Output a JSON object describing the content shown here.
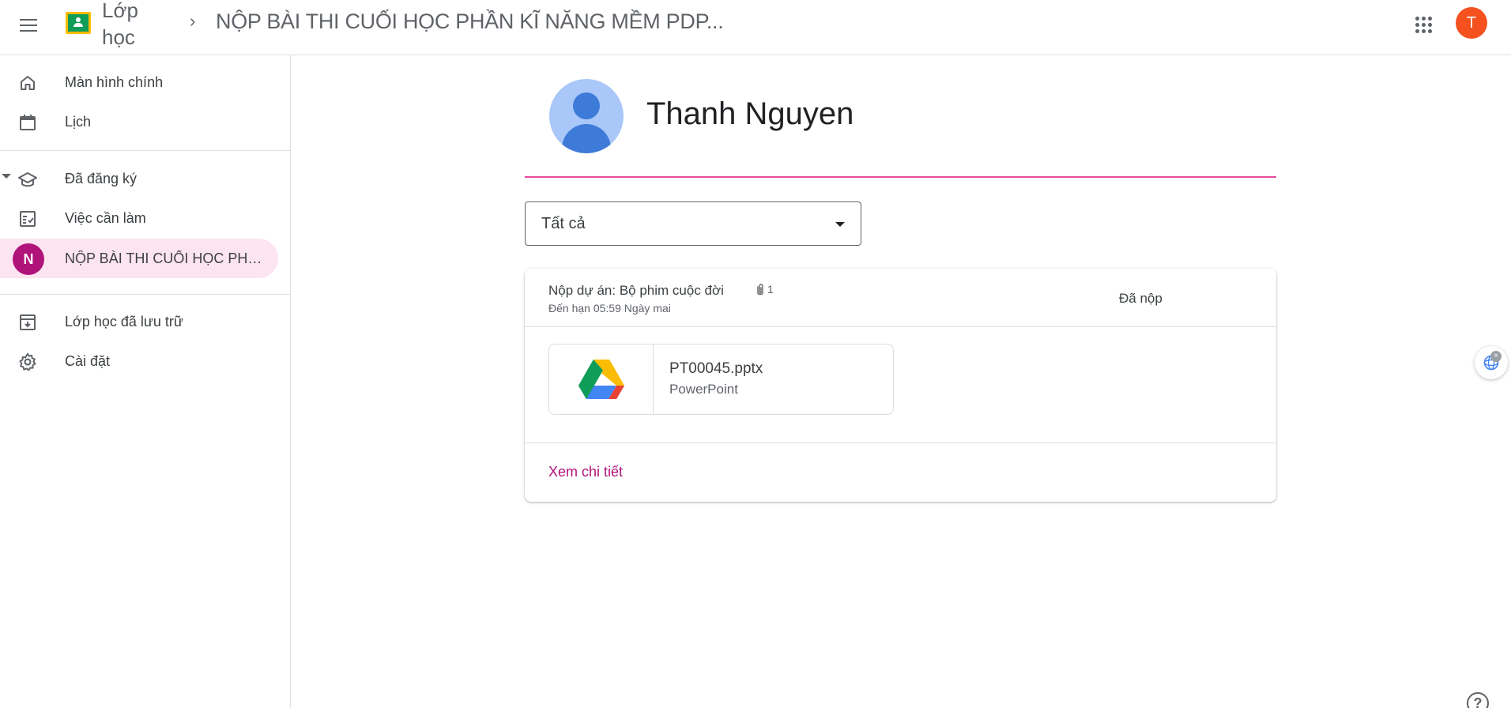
{
  "header": {
    "app_name": "Lớp học",
    "breadcrumb_separator": "›",
    "class_title": "NỘP BÀI THI CUỐI HỌC PHẦN KĨ NĂNG MỀM PDP...",
    "account_initial": "T"
  },
  "sidebar": {
    "items": [
      {
        "label": "Màn hình chính",
        "icon": "home-icon"
      },
      {
        "label": "Lịch",
        "icon": "calendar-icon"
      },
      {
        "label": "Đã đăng ký",
        "icon": "school-icon"
      },
      {
        "label": "Việc cần làm",
        "icon": "checklist-icon"
      },
      {
        "label": "NỘP BÀI THI CUỐI HỌC PHẦN KĨ NĂNG MỀM PDP",
        "icon": "class-avatar",
        "avatar_letter": "N",
        "active": true
      },
      {
        "label": "Lớp học đã lưu trữ",
        "icon": "archive-icon"
      },
      {
        "label": "Cài đặt",
        "icon": "gear-icon"
      }
    ]
  },
  "student": {
    "name": "Thanh Nguyen"
  },
  "filter": {
    "selected": "Tất cả"
  },
  "assignment": {
    "title": "Nộp dự án: Bộ phim cuộc đời",
    "attachment_count": "1",
    "due": "Đến hạn 05:59 Ngày mai",
    "status": "Đã nộp",
    "file": {
      "name": "PT00045.pptx",
      "type": "PowerPoint"
    },
    "details_link": "Xem chi tiết"
  },
  "widgets": {
    "close_glyph": "×",
    "help_glyph": "?"
  },
  "colors": {
    "accent": "#b0137a",
    "name_rule": "#e8489a",
    "active_bg": "#fce4f1",
    "account_bg": "#f4511e"
  }
}
